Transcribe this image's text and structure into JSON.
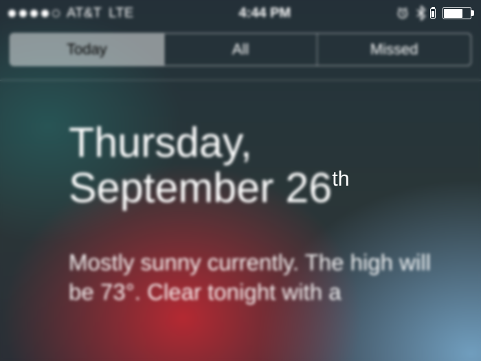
{
  "statusbar": {
    "signal_filled": 4,
    "signal_total": 5,
    "carrier": "AT&T",
    "network": "LTE",
    "time": "4:44 PM"
  },
  "tabs": {
    "items": [
      {
        "label": "Today",
        "active": true
      },
      {
        "label": "All",
        "active": false
      },
      {
        "label": "Missed",
        "active": false
      }
    ]
  },
  "today": {
    "date_weekday": "Thursday,",
    "date_month_day": "September 26",
    "date_ordinal": "th",
    "weather_text": "Mostly sunny currently. The high will be 73°. Clear tonight with a"
  }
}
